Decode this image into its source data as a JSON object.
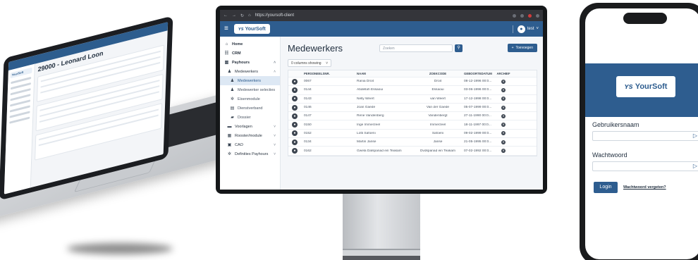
{
  "laptop": {
    "page_title": "29000 - Leonard Loon",
    "logo": "YourSoft"
  },
  "monitor": {
    "browser": {
      "url": "https://yoursoft-client"
    },
    "header": {
      "logo": "YourSoft",
      "user": "test"
    },
    "nav": [
      {
        "icon": "home-icon",
        "glyph": "⌂",
        "label": "Home",
        "level": 0,
        "bold": true
      },
      {
        "icon": "crm-icon",
        "glyph": "☷",
        "label": "CRM",
        "level": 0,
        "bold": true
      },
      {
        "icon": "chart-icon",
        "glyph": "▥",
        "label": "Payhours",
        "level": 0,
        "bold": true,
        "chev": "˄"
      },
      {
        "icon": "people-icon",
        "glyph": "♟",
        "label": "Medewerkers",
        "level": 1,
        "chev": "˄"
      },
      {
        "icon": "person-icon",
        "glyph": "♟",
        "label": "Medewerkers",
        "level": 2,
        "active": true
      },
      {
        "icon": "group-icon",
        "glyph": "♟",
        "label": "Medewerker selecties",
        "level": 2
      },
      {
        "icon": "gear-icon",
        "glyph": "✲",
        "label": "Eisenmodule",
        "level": 2
      },
      {
        "icon": "doc-icon",
        "glyph": "▤",
        "label": "Dienstverband",
        "level": 2
      },
      {
        "icon": "folder-icon",
        "glyph": "▰",
        "label": "Dossier",
        "level": 2
      },
      {
        "icon": "coins-icon",
        "glyph": "▬",
        "label": "Voorlagen",
        "level": 1,
        "chev": "˅"
      },
      {
        "icon": "report-icon",
        "glyph": "▦",
        "label": "Rooster/module",
        "level": 1,
        "chev": "˅"
      },
      {
        "icon": "cao-icon",
        "glyph": "▣",
        "label": "CAO",
        "level": 1,
        "chev": "˅"
      },
      {
        "icon": "settings-icon",
        "glyph": "✲",
        "label": "Definities Payhours",
        "level": 1,
        "chev": "˅"
      }
    ],
    "content": {
      "title": "Medewerkers",
      "search_placeholder": "Zoeken",
      "add_label": "Toevoegen",
      "columns_select": "0 columns showing"
    },
    "table": {
      "columns": [
        "PERSONEELSNR.",
        "NAAM",
        "ZOEKCODE",
        "GEBOORTEDATUM",
        "ARCHIEF"
      ],
      "rows": [
        {
          "nr": "0067",
          "name": "Rania Droit",
          "code": "Droit",
          "dob": "08-12-1996 00:0..."
        },
        {
          "nr": "0144",
          "name": "Abdellah Essaoui",
          "code": "Essaoui",
          "dob": "03-06-1996 00:0..."
        },
        {
          "nr": "0143",
          "name": "Nelly Weert",
          "code": "van Weert",
          "dob": "17-12-1998 00:0..."
        },
        {
          "nr": "0146",
          "name": "Joan Gaede",
          "code": "Van der Gaede",
          "dob": "05-07-1999 00:0..."
        },
        {
          "nr": "0147",
          "name": "Rene Vandenberg",
          "code": "Vandenbergt",
          "dob": "27-11-1990 00:0..."
        },
        {
          "nr": "0150",
          "name": "Inge Immerzeel",
          "code": "Immerzeel",
          "dob": "18-11-1997 00:0..."
        },
        {
          "nr": "0152",
          "name": "Lotti Safoeni",
          "code": "Safoeni",
          "dob": "09-02-1999 00:0..."
        },
        {
          "nr": "0134",
          "name": "Martin Janse",
          "code": "Janse",
          "dob": "21-05-1995 00:0..."
        },
        {
          "nr": "0162",
          "name": "Gwela Dalspanad ein Teakam",
          "code": "Dvdspanad ein Teakam",
          "dob": "07-02-1992 00:0..."
        }
      ]
    }
  },
  "phone": {
    "logo": "YourSoft",
    "username_label": "Gebruikersnaam",
    "password_label": "Wachtwoord",
    "login_label": "Login",
    "forgot_label": "Wachtwoord vergeten?"
  },
  "colors": {
    "brand": "#2e5d8f"
  }
}
